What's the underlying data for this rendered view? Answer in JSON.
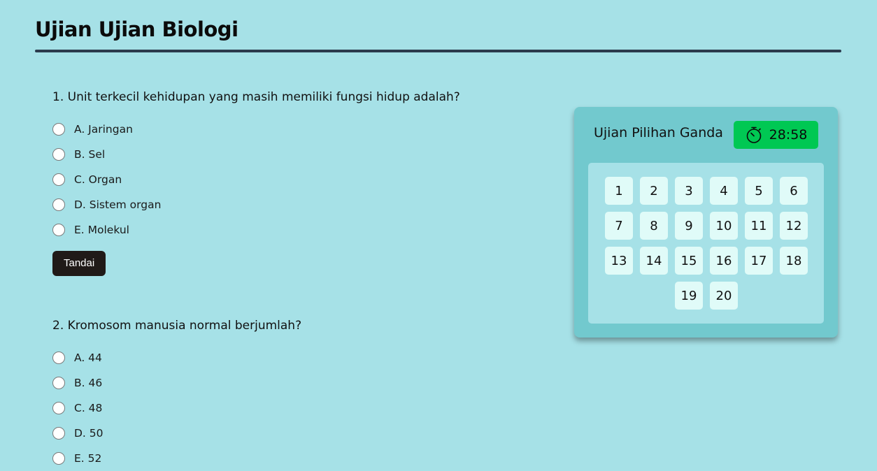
{
  "page": {
    "title": "Ujian Ujian Biologi"
  },
  "questions": [
    {
      "text": "1. Unit terkecil kehidupan yang masih memiliki fungsi hidup adalah?",
      "options": [
        "A. Jaringan",
        "B. Sel",
        "C. Organ",
        "D. Sistem organ",
        "E. Molekul"
      ],
      "mark_label": "Tandai"
    },
    {
      "text": "2. Kromosom manusia normal berjumlah?",
      "options": [
        "A. 44",
        "B. 46",
        "C. 48",
        "D. 50",
        "E. 52"
      ]
    }
  ],
  "panel": {
    "title": "Ujian Pilihan Ganda",
    "timer": "28:58",
    "timer_icon": "stopwatch-icon",
    "timer_color": "#00c853",
    "numbers": [
      "1",
      "2",
      "3",
      "4",
      "5",
      "6",
      "7",
      "8",
      "9",
      "10",
      "11",
      "12",
      "13",
      "14",
      "15",
      "16",
      "17",
      "18",
      "19",
      "20"
    ]
  }
}
